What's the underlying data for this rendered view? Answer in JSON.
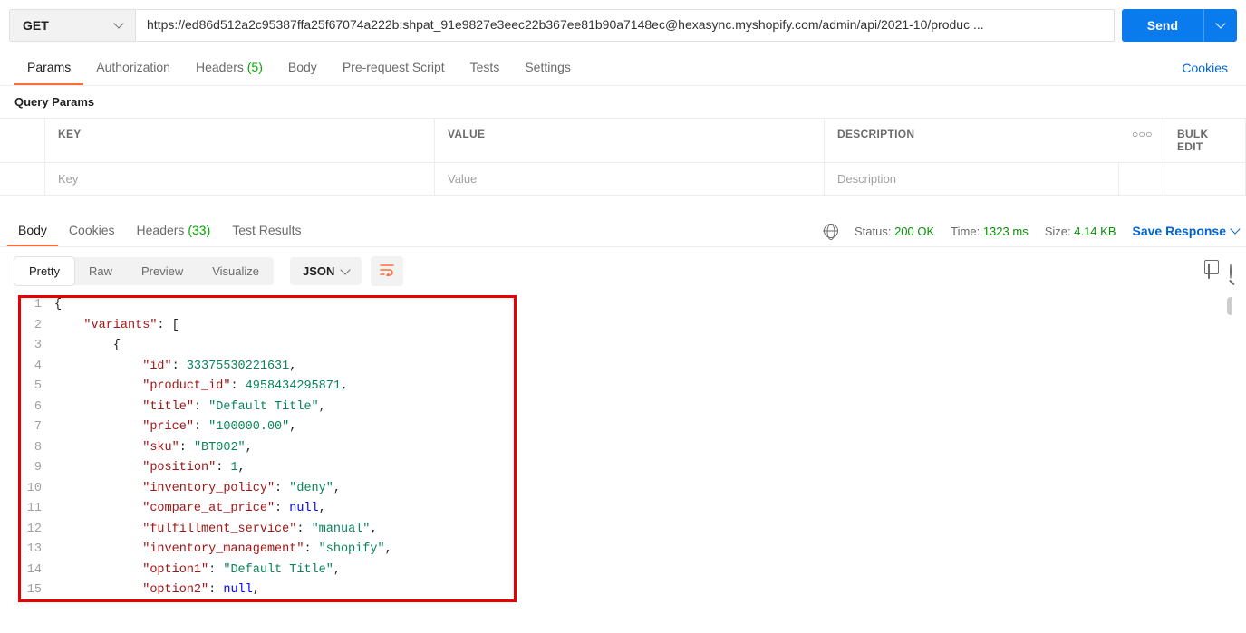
{
  "request": {
    "method": "GET",
    "url": "https://ed86d512a2c95387ffa25f67074a222b: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@hexasync.myshopify.com/admin/api/2021-10/produc ...",
    "send_label": "Send"
  },
  "request_tabs": {
    "params": "Params",
    "authorization": "Authorization",
    "headers": "Headers",
    "headers_count": "(5)",
    "body": "Body",
    "prerequest": "Pre-request Script",
    "tests": "Tests",
    "settings": "Settings",
    "cookies": "Cookies"
  },
  "query_params": {
    "title": "Query Params",
    "key_header": "KEY",
    "value_header": "VALUE",
    "desc_header": "DESCRIPTION",
    "bulk_edit": "Bulk Edit",
    "key_placeholder": "Key",
    "value_placeholder": "Value",
    "desc_placeholder": "Description",
    "more": "○○○"
  },
  "response_tabs": {
    "body": "Body",
    "cookies": "Cookies",
    "headers": "Headers",
    "headers_count": "(33)",
    "test_results": "Test Results"
  },
  "response_meta": {
    "status_label": "Status:",
    "status_value": "200 OK",
    "time_label": "Time:",
    "time_value": "1323 ms",
    "size_label": "Size:",
    "size_value": "4.14 KB",
    "save_response": "Save Response"
  },
  "view_tabs": {
    "pretty": "Pretty",
    "raw": "Raw",
    "preview": "Preview",
    "visualize": "Visualize",
    "format": "JSON"
  },
  "code_lines": [
    {
      "n": "1",
      "html": "<span class='brace'>{</span>"
    },
    {
      "n": "2",
      "html": "    <span class='key'>\"variants\"</span><span class='punc'>: [</span>"
    },
    {
      "n": "3",
      "html": "        <span class='brace'>{</span>"
    },
    {
      "n": "4",
      "html": "            <span class='key'>\"id\"</span><span class='punc'>: </span><span class='num'>33375530221631</span><span class='punc'>,</span>"
    },
    {
      "n": "5",
      "html": "            <span class='key'>\"product_id\"</span><span class='punc'>: </span><span class='num'>4958434295871</span><span class='punc'>,</span>"
    },
    {
      "n": "6",
      "html": "            <span class='key'>\"title\"</span><span class='punc'>: </span><span class='str'>\"Default Title\"</span><span class='punc'>,</span>"
    },
    {
      "n": "7",
      "html": "            <span class='key'>\"price\"</span><span class='punc'>: </span><span class='str'>\"100000.00\"</span><span class='punc'>,</span>"
    },
    {
      "n": "8",
      "html": "            <span class='key'>\"sku\"</span><span class='punc'>: </span><span class='str'>\"BT002\"</span><span class='punc'>,</span>"
    },
    {
      "n": "9",
      "html": "            <span class='key'>\"position\"</span><span class='punc'>: </span><span class='num'>1</span><span class='punc'>,</span>"
    },
    {
      "n": "10",
      "html": "            <span class='key'>\"inventory_policy\"</span><span class='punc'>: </span><span class='str'>\"deny\"</span><span class='punc'>,</span>"
    },
    {
      "n": "11",
      "html": "            <span class='key'>\"compare_at_price\"</span><span class='punc'>: </span><span class='null'>null</span><span class='punc'>,</span>"
    },
    {
      "n": "12",
      "html": "            <span class='key'>\"fulfillment_service\"</span><span class='punc'>: </span><span class='str'>\"manual\"</span><span class='punc'>,</span>"
    },
    {
      "n": "13",
      "html": "            <span class='key'>\"inventory_management\"</span><span class='punc'>: </span><span class='str'>\"shopify\"</span><span class='punc'>,</span>"
    },
    {
      "n": "14",
      "html": "            <span class='key'>\"option1\"</span><span class='punc'>: </span><span class='str'>\"Default Title\"</span><span class='punc'>,</span>"
    },
    {
      "n": "15",
      "html": "            <span class='key'>\"option2\"</span><span class='punc'>: </span><span class='null'>null</span><span class='punc'>,</span>"
    }
  ]
}
